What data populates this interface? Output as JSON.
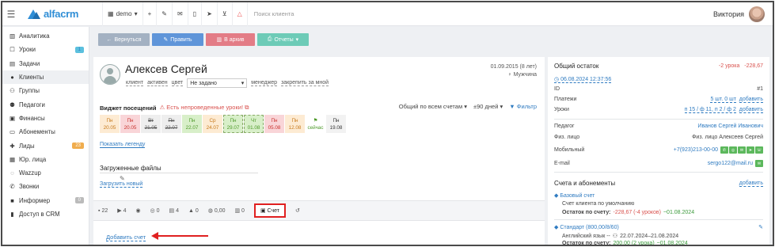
{
  "topbar": {
    "brand": "alfacrm",
    "demo": "demo",
    "demo_caret": "▾",
    "search_placeholder": "Поиск клиента",
    "user": "Виктория"
  },
  "sidebar": {
    "items": [
      {
        "label": "Аналитика",
        "icon": "chart-icon"
      },
      {
        "label": "Уроки",
        "icon": "calendar-icon",
        "badge": "1"
      },
      {
        "label": "Задачи",
        "icon": "tasks-icon"
      },
      {
        "label": "Клиенты",
        "icon": "user-icon"
      },
      {
        "label": "Группы",
        "icon": "users-icon"
      },
      {
        "label": "Педагоги",
        "icon": "teacher-icon"
      },
      {
        "label": "Финансы",
        "icon": "money-icon"
      },
      {
        "label": "Абонементы",
        "icon": "card-icon"
      },
      {
        "label": "Лиды",
        "icon": "lead-icon",
        "badge": "23"
      },
      {
        "label": "Юр. лица",
        "icon": "building-icon"
      },
      {
        "label": "Wazzup",
        "icon": "chat-icon"
      },
      {
        "label": "Звонки",
        "icon": "phone-icon"
      },
      {
        "label": "Информер",
        "icon": "info-icon",
        "badge": "0"
      },
      {
        "label": "Доступ в CRM",
        "icon": "lock-icon"
      }
    ]
  },
  "actions": {
    "back": "Вернуться",
    "edit": "Править",
    "archive": "В архив",
    "reports": "Отчеты"
  },
  "client": {
    "name": "Алексев Сергей",
    "type": "клиент",
    "status": "активен",
    "color": "цвет",
    "manager_select": "Не задано",
    "manager": "менеджер",
    "assign": "закрепить за мной",
    "birthdate": "01.09.2015 (8 лет)",
    "gender": "Мужчина"
  },
  "widget": {
    "title": "Виджет посещений",
    "warning": "Есть непроведенные уроки!",
    "scope": "Общий по всем счетам",
    "period": "±90 дней",
    "filter": "Фильтр",
    "days": [
      {
        "top": "Пн",
        "date": "20.05",
        "style": "orange"
      },
      {
        "top": "Пн",
        "date": "20.05",
        "style": "red"
      },
      {
        "top": "Вт",
        "date": "21.05",
        "style": "gray"
      },
      {
        "top": "Пн",
        "date": "22.07",
        "style": "gray"
      },
      {
        "top": "Пн",
        "date": "22.07",
        "style": "green"
      },
      {
        "top": "Ср",
        "date": "24.07",
        "style": "orange"
      },
      {
        "top": "Пн",
        "date": "29.07",
        "style": "greendash"
      },
      {
        "top": "Чт",
        "date": "01.08",
        "style": "greendash"
      },
      {
        "top": "Пн",
        "date": "05.08",
        "style": "red"
      },
      {
        "top": "Пн",
        "date": "12.08",
        "style": "orange"
      },
      {
        "top": "⚑",
        "date": "сейчас",
        "style": "plain"
      },
      {
        "top": "Пн",
        "date": "19.08",
        "style": "light"
      }
    ],
    "show_legend": "Показать легенду"
  },
  "files": {
    "title": "Загруженные файлы",
    "upload": "Загрузить новый"
  },
  "tabs": [
    {
      "label": "22",
      "icon": "comments-icon"
    },
    {
      "label": "4",
      "icon": "tasks-icon"
    },
    {
      "label": "",
      "icon": "whatsapp-icon"
    },
    {
      "label": "0",
      "icon": "sms-icon"
    },
    {
      "label": "4",
      "icon": "docs-icon"
    },
    {
      "label": "0",
      "icon": "person-icon"
    },
    {
      "label": "0,00",
      "icon": "payments-icon"
    },
    {
      "label": "0",
      "icon": "bar-icon"
    },
    {
      "label": "Счет",
      "icon": "account-icon",
      "active": true
    },
    {
      "label": "",
      "icon": "history-icon"
    }
  ],
  "add_account": "Добавить счет",
  "balance": {
    "title": "Общий остаток",
    "lessons": "-2 урока",
    "amount": "-228,67",
    "link": "06.08.2024 12:37:56",
    "id_label": "ID",
    "id_value": "#1",
    "payments_label": "Платежи",
    "payments_value": "5 шт. 0 шт",
    "payments_add": "добавить",
    "lessons_label": "Уроки",
    "lessons_value": "п 15 / ф 11, п 2 / ф 2",
    "lessons_add": "добавить"
  },
  "contacts": {
    "teacher_label": "Педагог",
    "teacher_value": "Иванов Сергей Иванович",
    "person_label": "Физ. лицо",
    "person_value": "Физ. лицо Алексеев Сергей",
    "mobile_label": "Мобильный",
    "mobile_value": "+7(923)213-00-00",
    "email_label": "E-mail",
    "email_value": "sergo122@mail.ru"
  },
  "accounts": {
    "title": "Счета и абонементы",
    "add": "добавить",
    "base_title": "Базовый счет",
    "base_desc": "Счет клиента по умолчанию",
    "base_rest_label": "Остаток по счету:",
    "base_rest_value": "-228,67 (-4 уроков)",
    "base_rest_date": "~01.08.2024",
    "std_title": "Стандарт (800,00/8/60)",
    "std_desc": "Английский язык -- ",
    "std_period": "22.07.2024–21.08.2024",
    "std_rest_label": "Остаток по счету:",
    "std_rest_value": "200,00 (2 урока)",
    "std_rest_date": "~01.08.2024"
  }
}
